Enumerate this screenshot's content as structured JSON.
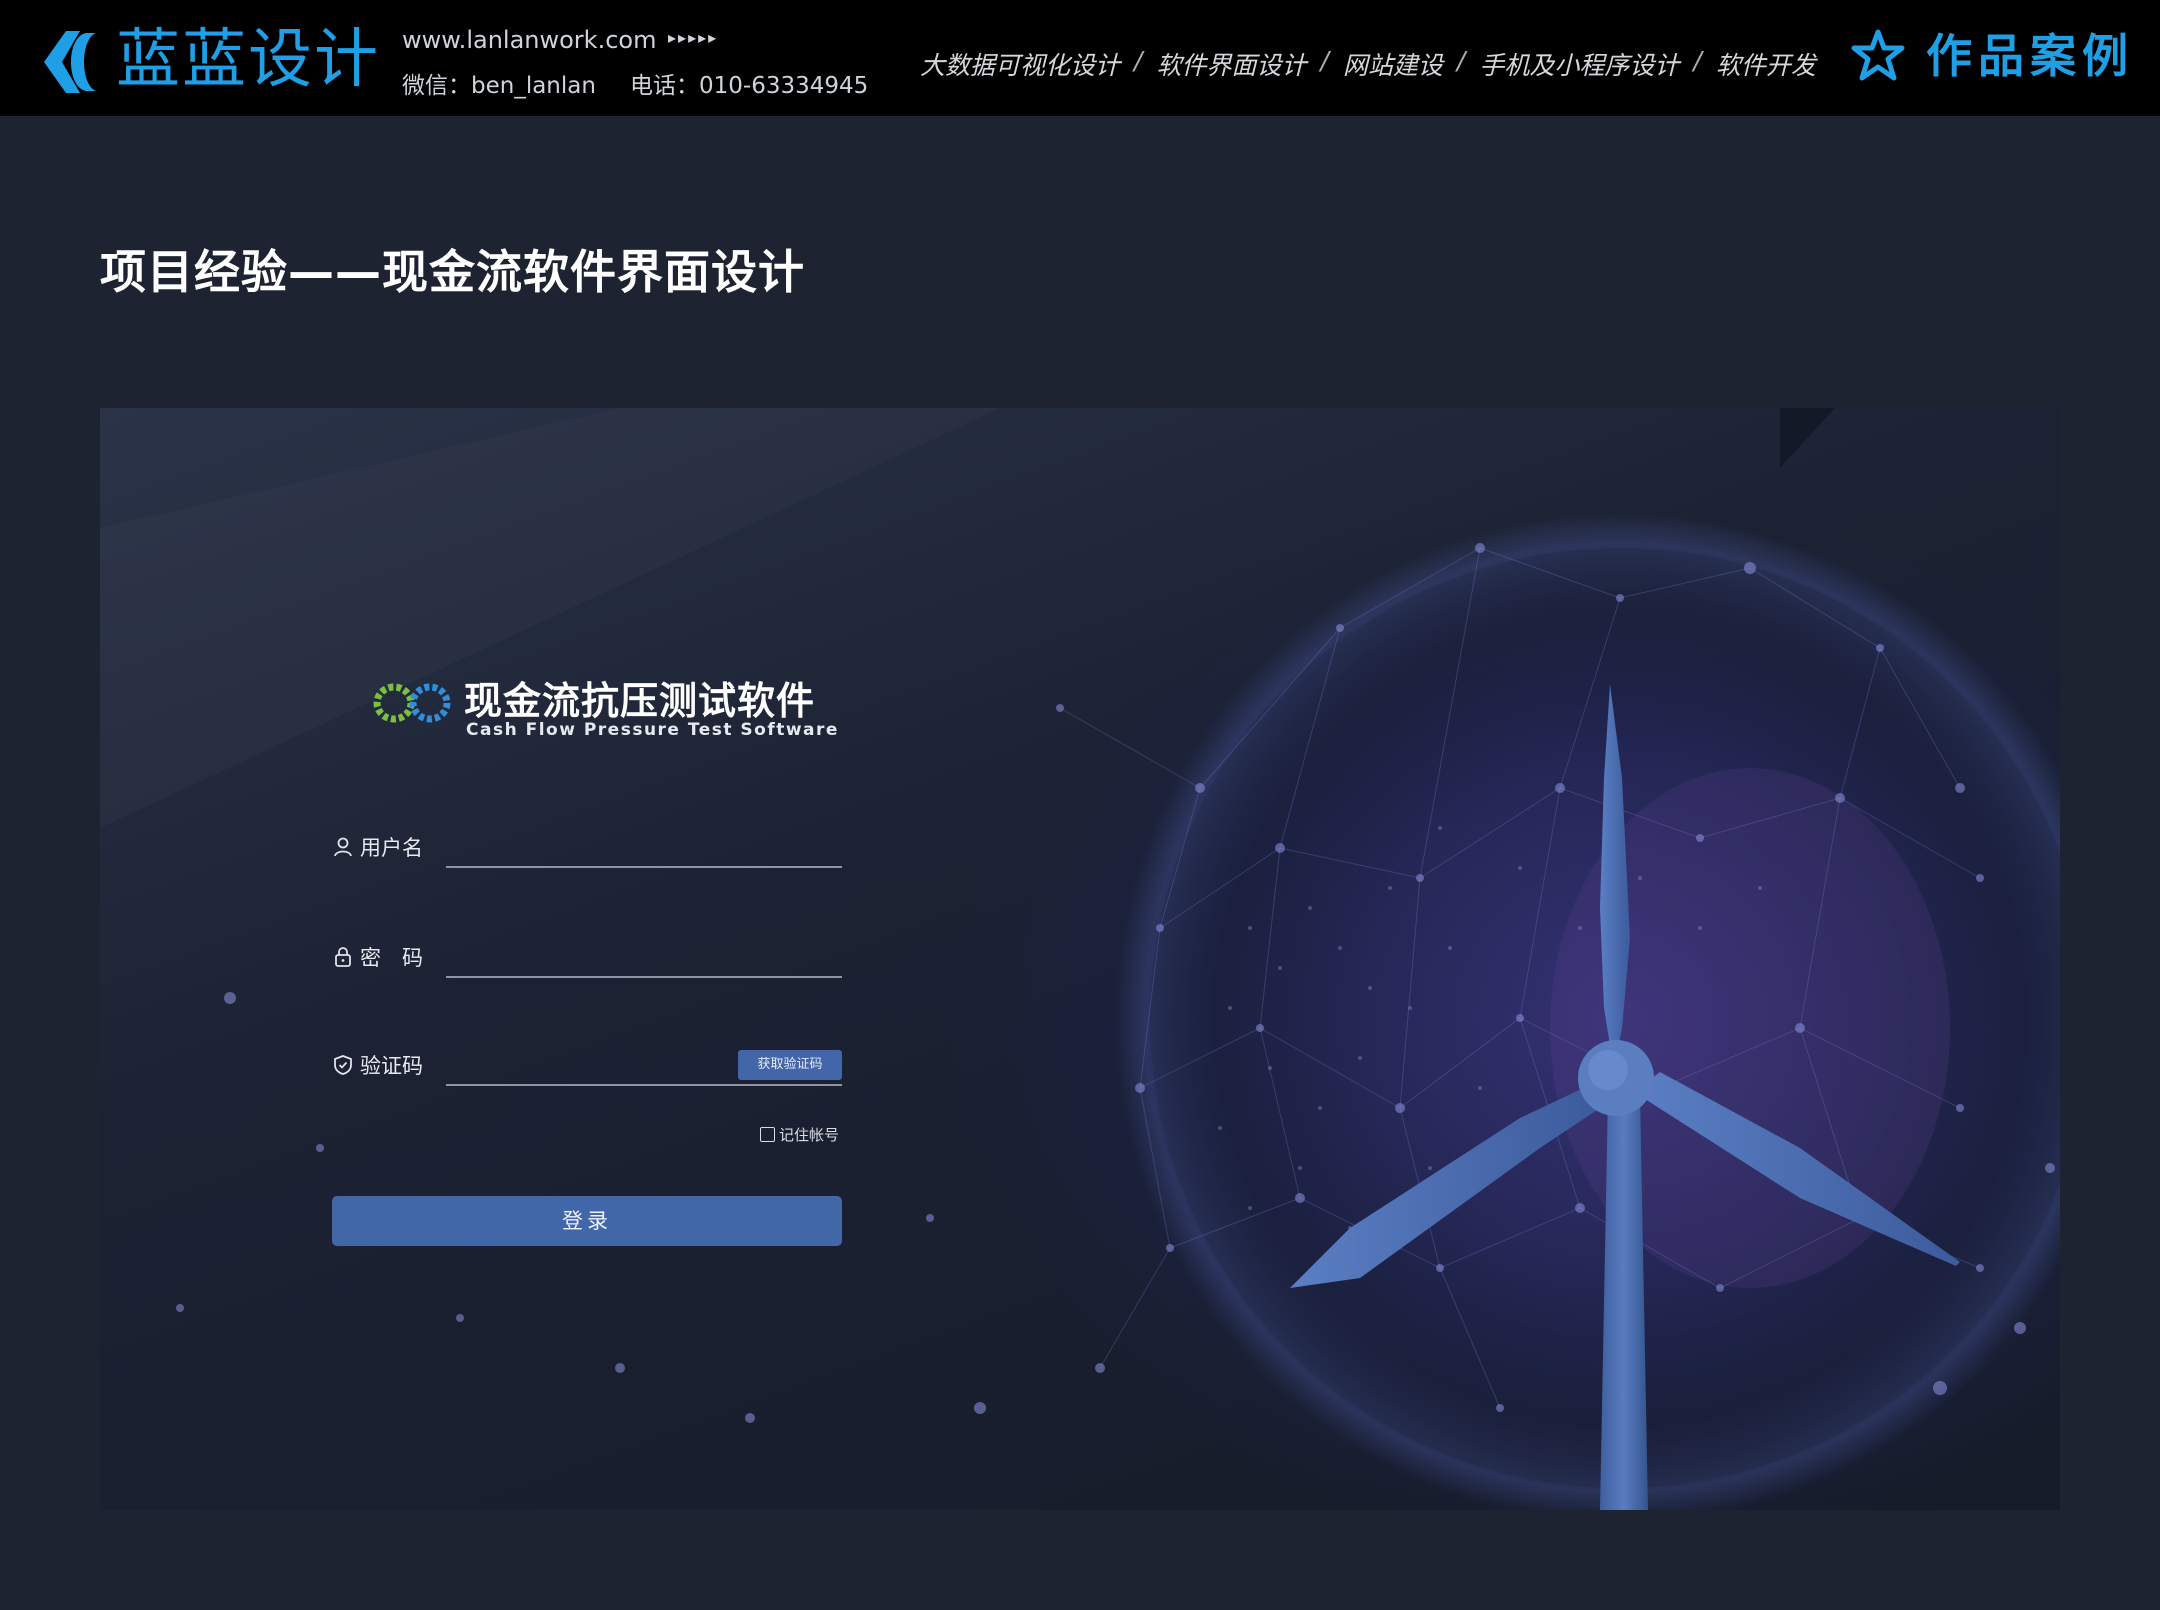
{
  "header": {
    "brand_name": "蓝蓝设计",
    "site_url": "www.lanlanwork.com",
    "site_arrows": "▸▸▸▸▸",
    "wechat": "微信：ben_lanlan",
    "phone": "电话：010-63334945",
    "services": [
      "大数据可视化设计",
      "软件界面设计",
      "网站建设",
      "手机及小程序设计",
      "软件开发"
    ],
    "separator": "/",
    "works_title": "作品案例"
  },
  "page": {
    "title": "项目经验——现金流软件界面设计"
  },
  "login": {
    "app_name_cn": "现金流抗压测试软件",
    "app_name_en": "Cash Flow Pressure Test Software",
    "username_label": "用户名",
    "password_label": "密　码",
    "captcha_label": "验证码",
    "get_code_button": "获取验证码",
    "remember_label": "记住帐号",
    "login_button": "登录"
  },
  "colors": {
    "brand": "#1fa0e6",
    "topbar_bg": "#000000",
    "page_bg": "#1d2331",
    "button": "#4267a8"
  }
}
